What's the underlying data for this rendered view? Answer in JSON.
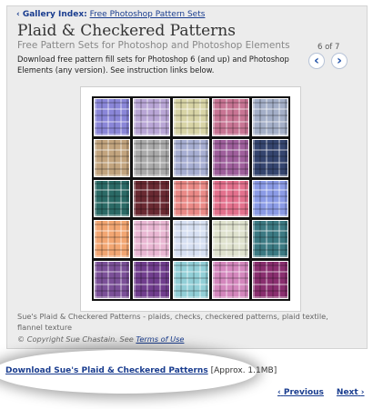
{
  "breadcrumb": {
    "index_label": "Gallery Index:",
    "link": "Free Photoshop Pattern Sets"
  },
  "header": {
    "title": "Plaid & Checkered Patterns",
    "subtitle": "Free Pattern Sets for Photoshop and Photoshop Elements",
    "description": "Download free pattern fill sets for Photoshop 6 (and up) and Photoshop Elements (any version). See instruction links below.",
    "counter": "6 of 7"
  },
  "nav_icons": {
    "prev": "chevron-left-icon",
    "next": "chevron-right-icon"
  },
  "patterns": [
    [
      "#8a86d8",
      "#b9a6d6",
      "#d8d4a6",
      "#c87594",
      "#a4afc8"
    ],
    [
      "#c2a47e",
      "#aaaaaa",
      "#a7aed2",
      "#9f5f9c",
      "#35456f"
    ],
    [
      "#2b6a66",
      "#6a2a32",
      "#ea8a87",
      "#e3718d",
      "#8b9be6"
    ],
    [
      "#f2a672",
      "#e9b7d3",
      "#d7e0f2",
      "#dfe2ce",
      "#3c7a83"
    ],
    [
      "#7b5098",
      "#713e8e",
      "#92cfd7",
      "#d487bd",
      "#8a2f6f"
    ]
  ],
  "caption": "Sue's Plaid & Checkered Patterns - plaids, checks, checkered patterns, plaid textile, flannel texture",
  "copyright": {
    "text": "© Copyright Sue Chastain. See ",
    "link": "Terms of Use"
  },
  "download": {
    "link": "Download Sue's Plaid & Checkered Patterns",
    "size": "[Approx. 1.1MB]"
  },
  "pager": {
    "prev_arrow": "‹",
    "prev": "Previous",
    "next": "Next",
    "next_arrow": "›"
  }
}
